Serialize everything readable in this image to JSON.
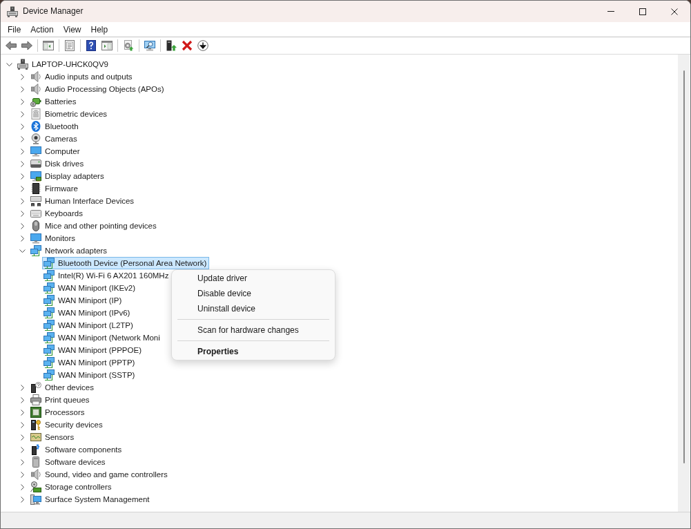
{
  "window": {
    "title": "Device Manager"
  },
  "menu_bar": [
    "File",
    "Action",
    "View",
    "Help"
  ],
  "tree": [
    {
      "label": "LAPTOP-UHCK0QV9",
      "expanded": true,
      "selected": false,
      "children": [
        {
          "label": "Audio inputs and outputs",
          "expanded": false,
          "selected": false
        },
        {
          "label": "Audio Processing Objects (APOs)",
          "expanded": false,
          "selected": false
        },
        {
          "label": "Batteries",
          "expanded": false,
          "selected": false
        },
        {
          "label": "Biometric devices",
          "expanded": false,
          "selected": false
        },
        {
          "label": "Bluetooth",
          "expanded": false,
          "selected": false
        },
        {
          "label": "Cameras",
          "expanded": false,
          "selected": false
        },
        {
          "label": "Computer",
          "expanded": false,
          "selected": false
        },
        {
          "label": "Disk drives",
          "expanded": false,
          "selected": false
        },
        {
          "label": "Display adapters",
          "expanded": false,
          "selected": false
        },
        {
          "label": "Firmware",
          "expanded": false,
          "selected": false
        },
        {
          "label": "Human Interface Devices",
          "expanded": false,
          "selected": false
        },
        {
          "label": "Keyboards",
          "expanded": false,
          "selected": false
        },
        {
          "label": "Mice and other pointing devices",
          "expanded": false,
          "selected": false
        },
        {
          "label": "Monitors",
          "expanded": false,
          "selected": false
        },
        {
          "label": "Network adapters",
          "expanded": true,
          "selected": false,
          "children": [
            {
              "label": "Bluetooth Device (Personal Area Network)",
              "selected": true
            },
            {
              "label": "Intel(R) Wi-Fi 6 AX201 160MHz",
              "selected": false
            },
            {
              "label": "WAN Miniport (IKEv2)",
              "selected": false
            },
            {
              "label": "WAN Miniport (IP)",
              "selected": false
            },
            {
              "label": "WAN Miniport (IPv6)",
              "selected": false
            },
            {
              "label": "WAN Miniport (L2TP)",
              "selected": false
            },
            {
              "label": "WAN Miniport (Network Moni",
              "selected": false
            },
            {
              "label": "WAN Miniport (PPPOE)",
              "selected": false
            },
            {
              "label": "WAN Miniport (PPTP)",
              "selected": false
            },
            {
              "label": "WAN Miniport (SSTP)",
              "selected": false
            }
          ]
        },
        {
          "label": "Other devices",
          "expanded": false,
          "selected": false
        },
        {
          "label": "Print queues",
          "expanded": false,
          "selected": false
        },
        {
          "label": "Processors",
          "expanded": false,
          "selected": false
        },
        {
          "label": "Security devices",
          "expanded": false,
          "selected": false
        },
        {
          "label": "Sensors",
          "expanded": false,
          "selected": false
        },
        {
          "label": "Software components",
          "expanded": false,
          "selected": false
        },
        {
          "label": "Software devices",
          "expanded": false,
          "selected": false
        },
        {
          "label": "Sound, video and game controllers",
          "expanded": false,
          "selected": false
        },
        {
          "label": "Storage controllers",
          "expanded": false,
          "selected": false
        },
        {
          "label": "Surface System Management",
          "expanded": false,
          "selected": false
        }
      ]
    }
  ],
  "context_menu": {
    "items": [
      {
        "kind": "item",
        "label": "Update driver",
        "default": false
      },
      {
        "kind": "item",
        "label": "Disable device",
        "default": false
      },
      {
        "kind": "item",
        "label": "Uninstall device",
        "default": false
      },
      {
        "kind": "separator"
      },
      {
        "kind": "item",
        "label": "Scan for hardware changes",
        "default": false
      },
      {
        "kind": "separator"
      },
      {
        "kind": "item",
        "label": "Properties",
        "default": true
      }
    ]
  }
}
